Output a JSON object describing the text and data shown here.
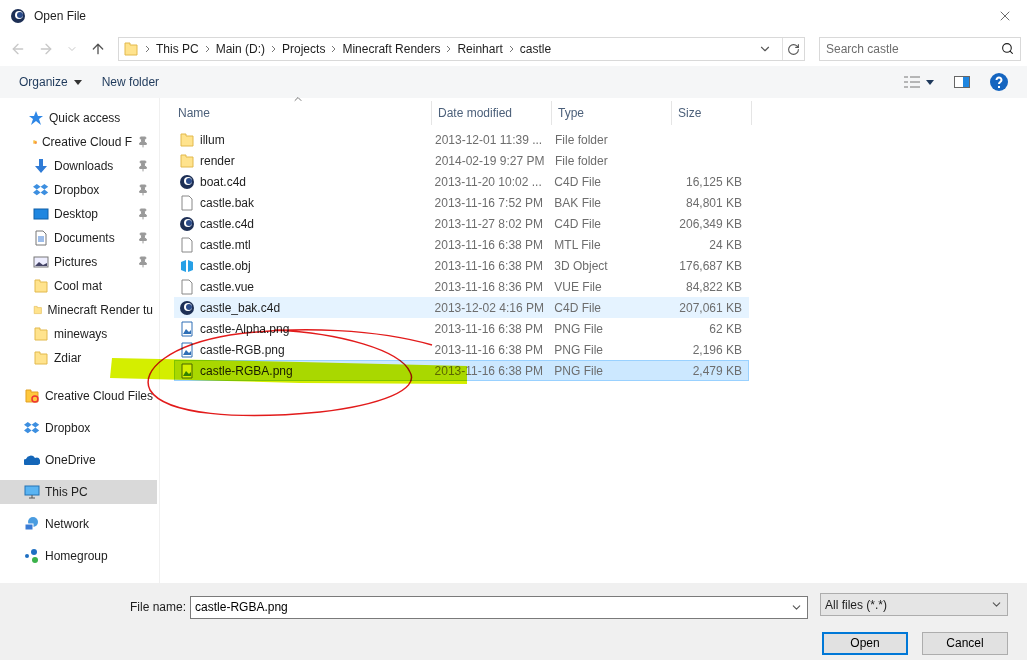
{
  "window": {
    "title": "Open File"
  },
  "address": {
    "path": [
      "This PC",
      "Main (D:)",
      "Projects",
      "Minecraft Renders",
      "Reinhart",
      "castle"
    ]
  },
  "search": {
    "placeholder": "Search castle"
  },
  "toolbar": {
    "buttons": [
      {
        "label": "Organize",
        "dropdown": true
      },
      {
        "label": "New folder",
        "dropdown": false
      }
    ]
  },
  "sidebar": {
    "items": [
      {
        "label": "Quick access",
        "kind": "star",
        "selected": false,
        "children": [
          {
            "label": "Creative Cloud F",
            "kind": "cloudfolder",
            "pinned": true,
            "selected": false
          },
          {
            "label": "Downloads",
            "kind": "download",
            "pinned": true,
            "selected": false
          },
          {
            "label": "Dropbox",
            "kind": "dropbox",
            "pinned": true,
            "selected": false
          },
          {
            "label": "Desktop",
            "kind": "desktop",
            "pinned": true,
            "selected": false
          },
          {
            "label": "Documents",
            "kind": "document",
            "pinned": true,
            "selected": false
          },
          {
            "label": "Pictures",
            "kind": "pictures",
            "pinned": true,
            "selected": false
          },
          {
            "label": "Cool mat",
            "kind": "folder",
            "pinned": false,
            "selected": false
          },
          {
            "label": "Minecraft Render tu",
            "kind": "folder",
            "pinned": false,
            "selected": false
          },
          {
            "label": "mineways",
            "kind": "folder",
            "pinned": false,
            "selected": false
          },
          {
            "label": "Zdiar",
            "kind": "folder",
            "pinned": false,
            "selected": false
          }
        ]
      },
      {
        "label": "Creative Cloud Files",
        "kind": "cloudfolder",
        "selected": false
      },
      {
        "label": "Dropbox",
        "kind": "dropbox",
        "selected": false
      },
      {
        "label": "OneDrive",
        "kind": "onedrive",
        "selected": false
      },
      {
        "label": "This PC",
        "kind": "pc",
        "selected": true
      },
      {
        "label": "Network",
        "kind": "network",
        "selected": false
      },
      {
        "label": "Homegroup",
        "kind": "homegroup",
        "selected": false
      }
    ]
  },
  "table": {
    "columns": [
      "Name",
      "Date modified",
      "Type",
      "Size"
    ],
    "rows": [
      {
        "name": "illum",
        "date": "2013-12-01 11:39 ...",
        "type": "File folder",
        "kind": "folder",
        "selected": false,
        "hovered": false
      },
      {
        "name": "render",
        "date": "2014-02-19 9:27 PM",
        "type": "File folder",
        "kind": "folder",
        "selected": false,
        "hovered": false
      },
      {
        "name": "boat.c4d",
        "date": "2013-11-20 10:02 ...",
        "type": "C4D File",
        "size": "16,125 KB",
        "kind": "c4d",
        "selected": false,
        "hovered": false
      },
      {
        "name": "castle.bak",
        "date": "2013-11-16 7:52 PM",
        "type": "BAK File",
        "size": "84,801 KB",
        "kind": "file",
        "selected": false,
        "hovered": false
      },
      {
        "name": "castle.c4d",
        "date": "2013-11-27 8:02 PM",
        "type": "C4D File",
        "size": "206,349 KB",
        "kind": "c4d",
        "selected": false,
        "hovered": false
      },
      {
        "name": "castle.mtl",
        "date": "2013-11-16 6:38 PM",
        "type": "MTL File",
        "size": "24 KB",
        "kind": "file",
        "selected": false,
        "hovered": false
      },
      {
        "name": "castle.obj",
        "date": "2013-11-16 6:38 PM",
        "type": "3D Object",
        "size": "176,687 KB",
        "kind": "obj",
        "selected": false,
        "hovered": false
      },
      {
        "name": "castle.vue",
        "date": "2013-11-16 8:36 PM",
        "type": "VUE File",
        "size": "84,822 KB",
        "kind": "file",
        "selected": false,
        "hovered": false
      },
      {
        "name": "castle_bak.c4d",
        "date": "2013-12-02 4:16 PM",
        "type": "C4D File",
        "size": "207,061 KB",
        "kind": "c4d",
        "selected": false,
        "hovered": true
      },
      {
        "name": "castle-Alpha.png",
        "date": "2013-11-16 6:38 PM",
        "type": "PNG File",
        "size": "62 KB",
        "kind": "png",
        "selected": false,
        "hovered": false
      },
      {
        "name": "castle-RGB.png",
        "date": "2013-11-16 6:38 PM",
        "type": "PNG File",
        "size": "2,196 KB",
        "kind": "png",
        "selected": false,
        "hovered": false
      },
      {
        "name": "castle-RGBA.png",
        "date": "2013-11-16 6:38 PM",
        "type": "PNG File",
        "size": "2,479 KB",
        "kind": "pngmarked",
        "selected": true,
        "hovered": false
      }
    ]
  },
  "footer": {
    "file_name_label": "File name:",
    "file_name": "castle-RGBA.png",
    "filter": "All files (*.*)",
    "buttons": [
      {
        "label": "Open",
        "default": true
      },
      {
        "label": "Cancel",
        "default": false
      }
    ]
  },
  "annotations": {
    "highlighter_mark": true,
    "red_circle": true
  }
}
